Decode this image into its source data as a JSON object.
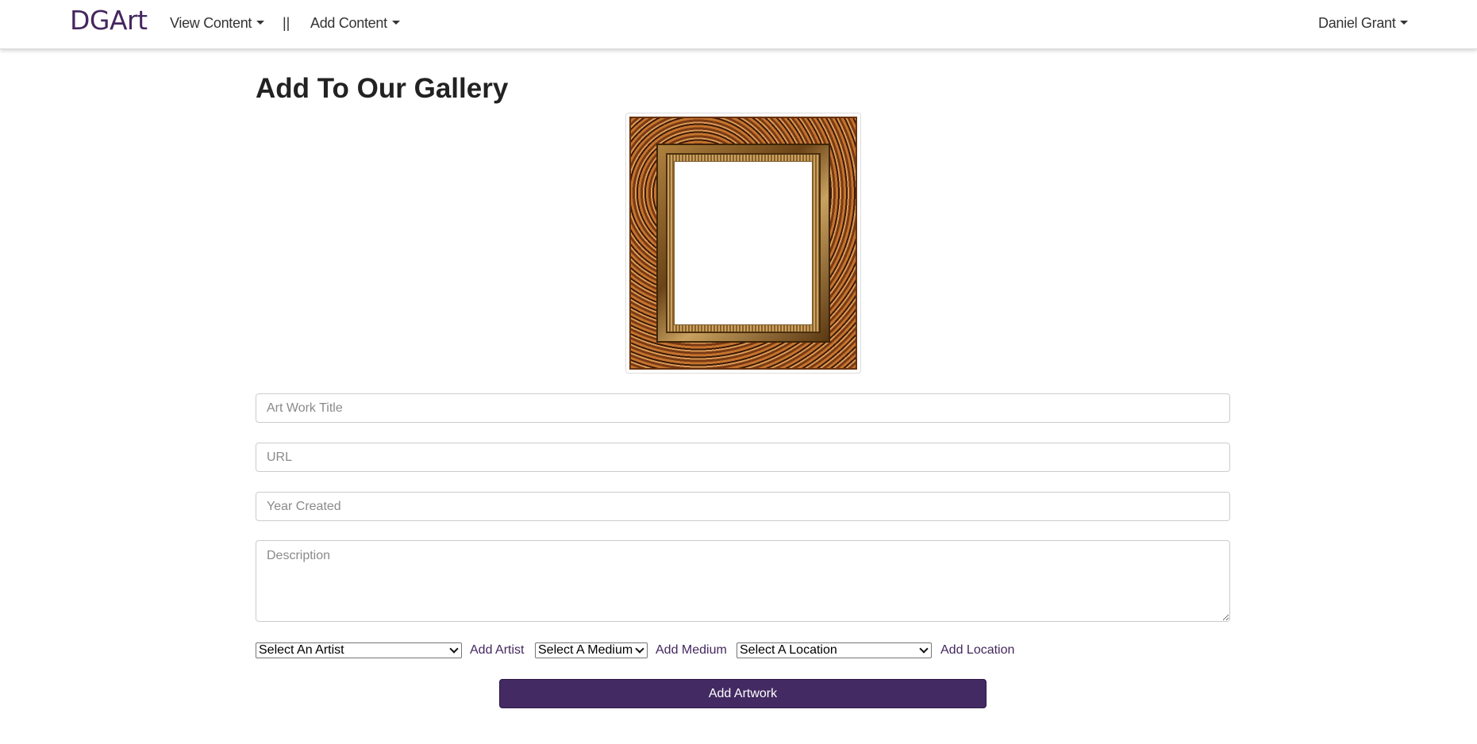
{
  "navbar": {
    "brand": "DGArt",
    "view_content": "View Content",
    "separator": "||",
    "add_content": "Add Content",
    "user": "Daniel Grant"
  },
  "page": {
    "title": "Add To Our Gallery"
  },
  "form": {
    "title_placeholder": "Art Work Title",
    "url_placeholder": "URL",
    "year_placeholder": "Year Created",
    "description_placeholder": "Description",
    "artist_select": "Select An Artist",
    "add_artist": "Add Artist",
    "medium_select": "Select A Medium",
    "add_medium": "Add Medium",
    "location_select": "Select A Location",
    "add_location": "Add Location",
    "submit_label": "Add Artwork"
  },
  "colors": {
    "brand": "#44275f",
    "button": "#432a62"
  }
}
